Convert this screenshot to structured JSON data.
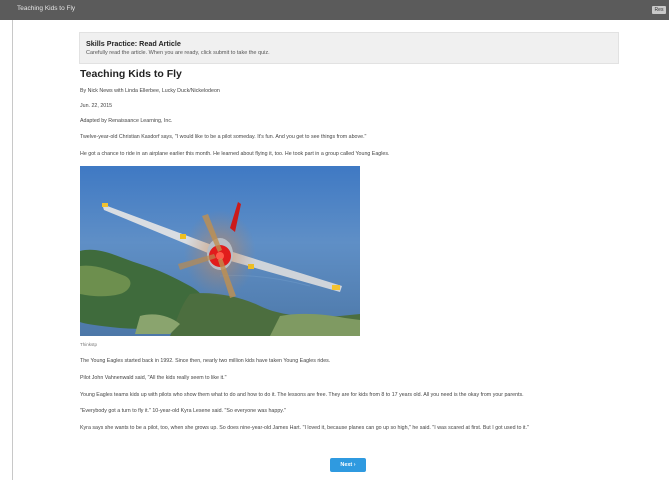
{
  "window": {
    "title": "Teaching Kids to Fly",
    "corner_button": "Res"
  },
  "instructions": {
    "heading": "Skills Practice: Read Article",
    "text": "Carefully read the article. When you are ready, click submit to take the quiz."
  },
  "article": {
    "title": "Teaching Kids to Fly",
    "byline": "By Nick News with Linda Ellerbee, Lucky Duck/Nickelodeon",
    "date": "Jun. 22, 2015",
    "adapted": "Adapted by Renaissance Learning, Inc.",
    "para1": "Twelve-year-old Christian Kasdorf says, \"I would like to be a pilot someday. It's fun. And you get to see things from above.\"",
    "para2": "He got a chance to ride in an airplane earlier this month. He learned about flying it, too. He took part in a group called Young Eagles.",
    "photo_caption": "Thinkstp",
    "para3": "The Young Eagles started back in 1992. Since then, nearly two million kids have taken Young Eagles rides.",
    "para4": "Pilot John Vahnenwald said, \"All the kids really seem to like it.\"",
    "para5": "Young Eagles teams kids up with pilots who show them what to do and how to do it. The lessons are free. They are for kids from 8 to 17 years old. All you need is the okay from your parents.",
    "para6": "\"Everybody got a turn to fly it.\" 10-year-old Kyra Lesene said. \"So everyone was happy.\"",
    "para7": "Kyra says she wants to be a pilot, too, when she grows up. So does nine-year-old James Hart. \"I loved it, because planes can go up so high,\" he said. \"I was scared at first. But I got used to it.\""
  },
  "footer": {
    "next_label": "Next",
    "next_icon": "chevron-right-icon"
  }
}
